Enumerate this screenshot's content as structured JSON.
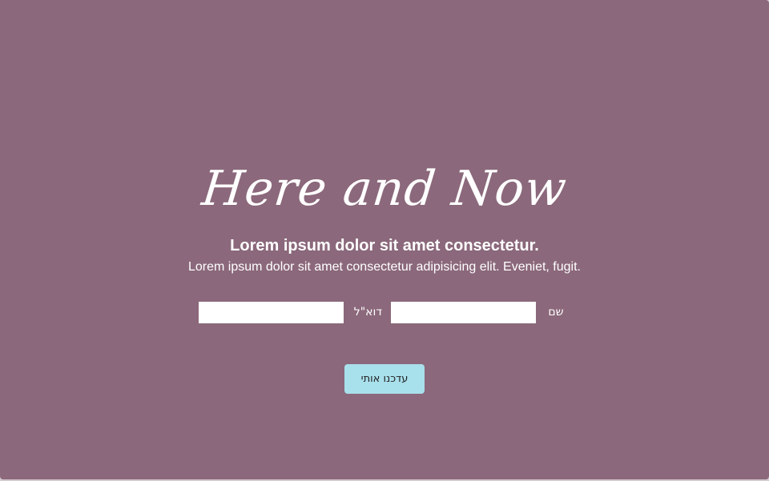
{
  "hero": {
    "title": "Here and Now",
    "subtitle": "Lorem ipsum dolor sit amet consectetur.",
    "description": "Lorem ipsum dolor sit amet consectetur adipisicing elit. Eveniet, fugit."
  },
  "form": {
    "name_label": "שם",
    "name_value": "",
    "email_label": "דוא\"ל",
    "email_value": "",
    "submit_label": "עדכנו אותי"
  },
  "colors": {
    "background": "#8b687b",
    "button": "#a8e0ec",
    "text": "#ffffff"
  }
}
